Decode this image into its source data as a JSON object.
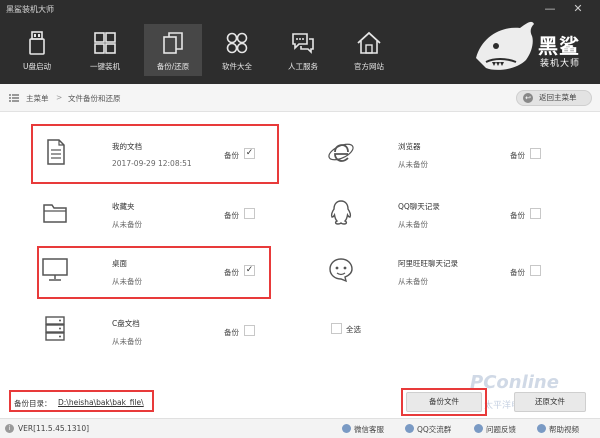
{
  "window": {
    "title": "黑鲨装机大师",
    "minimize": "—",
    "close": "✕"
  },
  "nav": {
    "items": [
      {
        "label": "U盘启动",
        "icon": "usb-drive-icon"
      },
      {
        "label": "一键装机",
        "icon": "windows-logo-icon"
      },
      {
        "label": "备份/还原",
        "icon": "backup-restore-icon",
        "active": true
      },
      {
        "label": "软件大全",
        "icon": "apps-grid-icon"
      },
      {
        "label": "人工服务",
        "icon": "chat-bubbles-icon"
      },
      {
        "label": "官方网站",
        "icon": "home-icon"
      }
    ]
  },
  "brand": {
    "line1": "黑鲨",
    "line2": "装机大师",
    "logo_icon": "shark-logo-icon"
  },
  "breadcrumb": {
    "root": "主菜单",
    "separator": ">",
    "current": "文件备份和还原",
    "back_button": "返回主菜单"
  },
  "backup_items": {
    "backup_label": "备份",
    "left": [
      {
        "name": "我的文档",
        "status": "2017-09-29 12:08:51",
        "checked": true,
        "highlighted": true,
        "icon": "document-icon"
      },
      {
        "name": "收藏夹",
        "status": "从未备份",
        "checked": false,
        "highlighted": false,
        "icon": "folder-icon"
      },
      {
        "name": "桌面",
        "status": "从未备份",
        "checked": true,
        "highlighted": true,
        "icon": "monitor-icon"
      },
      {
        "name": "C盘文档",
        "status": "从未备份",
        "checked": false,
        "highlighted": false,
        "icon": "server-drive-icon"
      }
    ],
    "right": [
      {
        "name": "浏览器",
        "status": "从未备份",
        "checked": false,
        "icon": "ie-browser-icon"
      },
      {
        "name": "QQ聊天记录",
        "status": "从未备份",
        "checked": false,
        "icon": "qq-penguin-icon"
      },
      {
        "name": "阿里旺旺聊天记录",
        "status": "从未备份",
        "checked": false,
        "icon": "aliwangwang-icon"
      }
    ]
  },
  "select_all": "全选",
  "backup_dir": {
    "label": "备份目录：",
    "path": "D:\\heisha\\bak\\bak_file\\"
  },
  "buttons": {
    "backup": "备份文件",
    "restore": "还原文件"
  },
  "watermark": {
    "brand": "PConline",
    "sub": "太平洋电脑网"
  },
  "statusbar": {
    "version": "VER[11.5.45.1310]",
    "links": [
      "微信客服",
      "QQ交流群",
      "问题反馈",
      "帮助视频"
    ]
  },
  "colors": {
    "header_bg": "#2d2d2d",
    "highlight_red": "#e83a3a",
    "active_tab": "#474747"
  }
}
